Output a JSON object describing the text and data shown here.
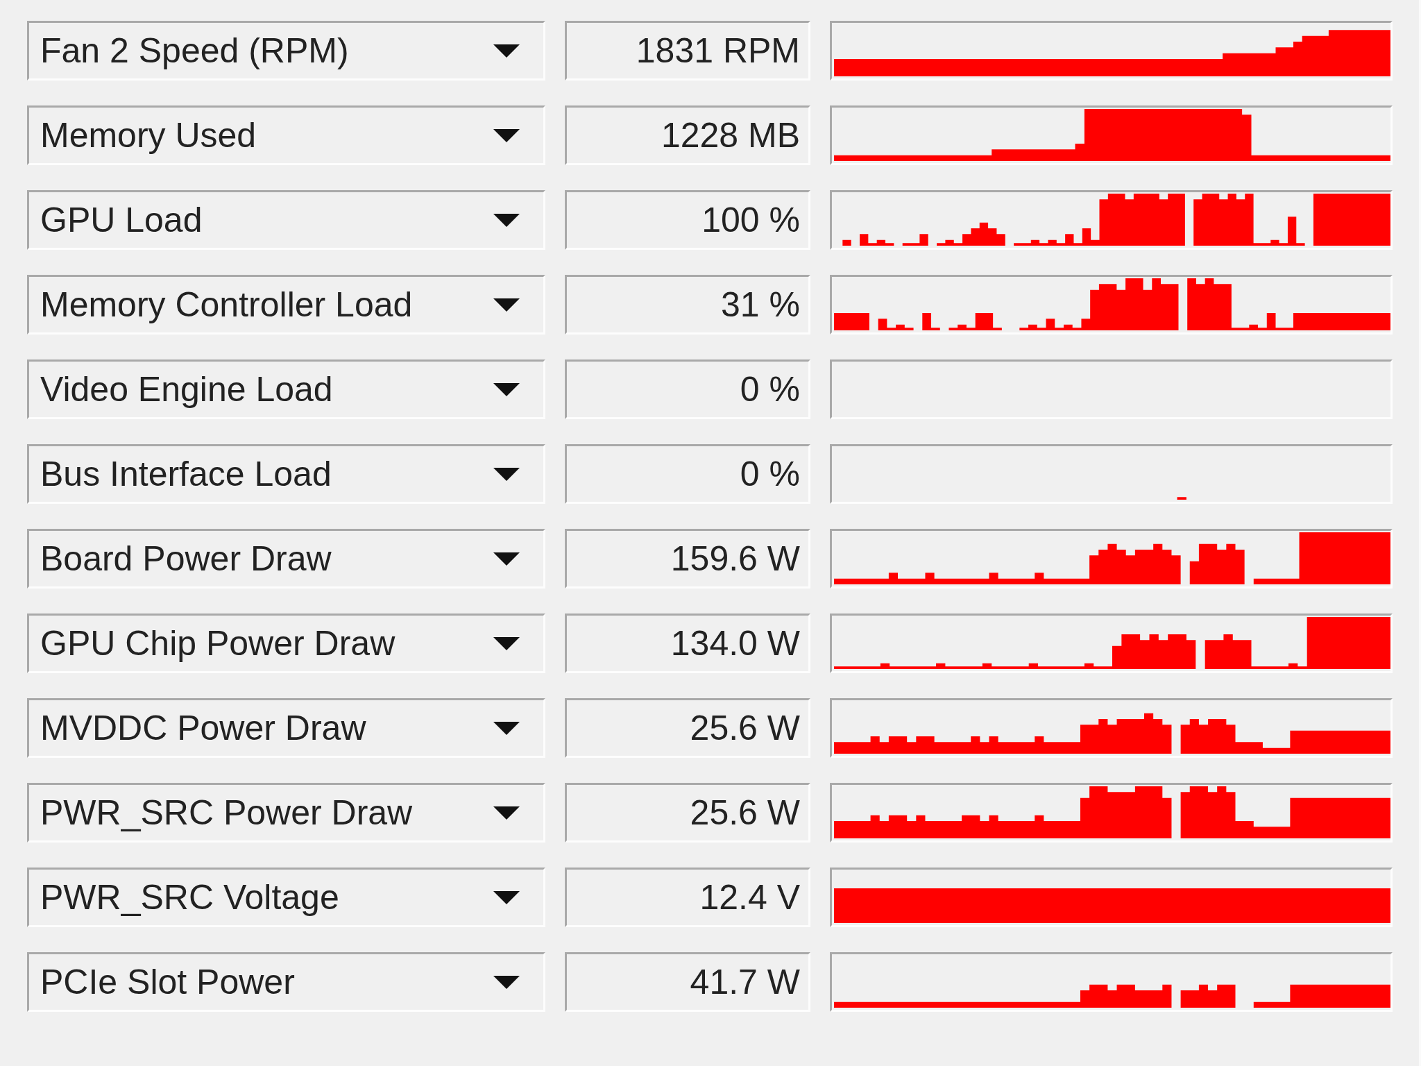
{
  "sensors": [
    {
      "name": "Fan 2 Speed (RPM)",
      "value": "1831 RPM"
    },
    {
      "name": "Memory Used",
      "value": "1228 MB"
    },
    {
      "name": "GPU Load",
      "value": "100 %"
    },
    {
      "name": "Memory Controller Load",
      "value": "31 %"
    },
    {
      "name": "Video Engine Load",
      "value": "0 %"
    },
    {
      "name": "Bus Interface Load",
      "value": "0 %"
    },
    {
      "name": "Board Power Draw",
      "value": "159.6 W"
    },
    {
      "name": "GPU Chip Power Draw",
      "value": "134.0 W"
    },
    {
      "name": "MVDDC Power Draw",
      "value": "25.6 W"
    },
    {
      "name": "PWR_SRC Power Draw",
      "value": "25.6 W"
    },
    {
      "name": "PWR_SRC Voltage",
      "value": "12.4 V"
    },
    {
      "name": "PCIe Slot Power",
      "value": "41.7 W"
    }
  ]
}
